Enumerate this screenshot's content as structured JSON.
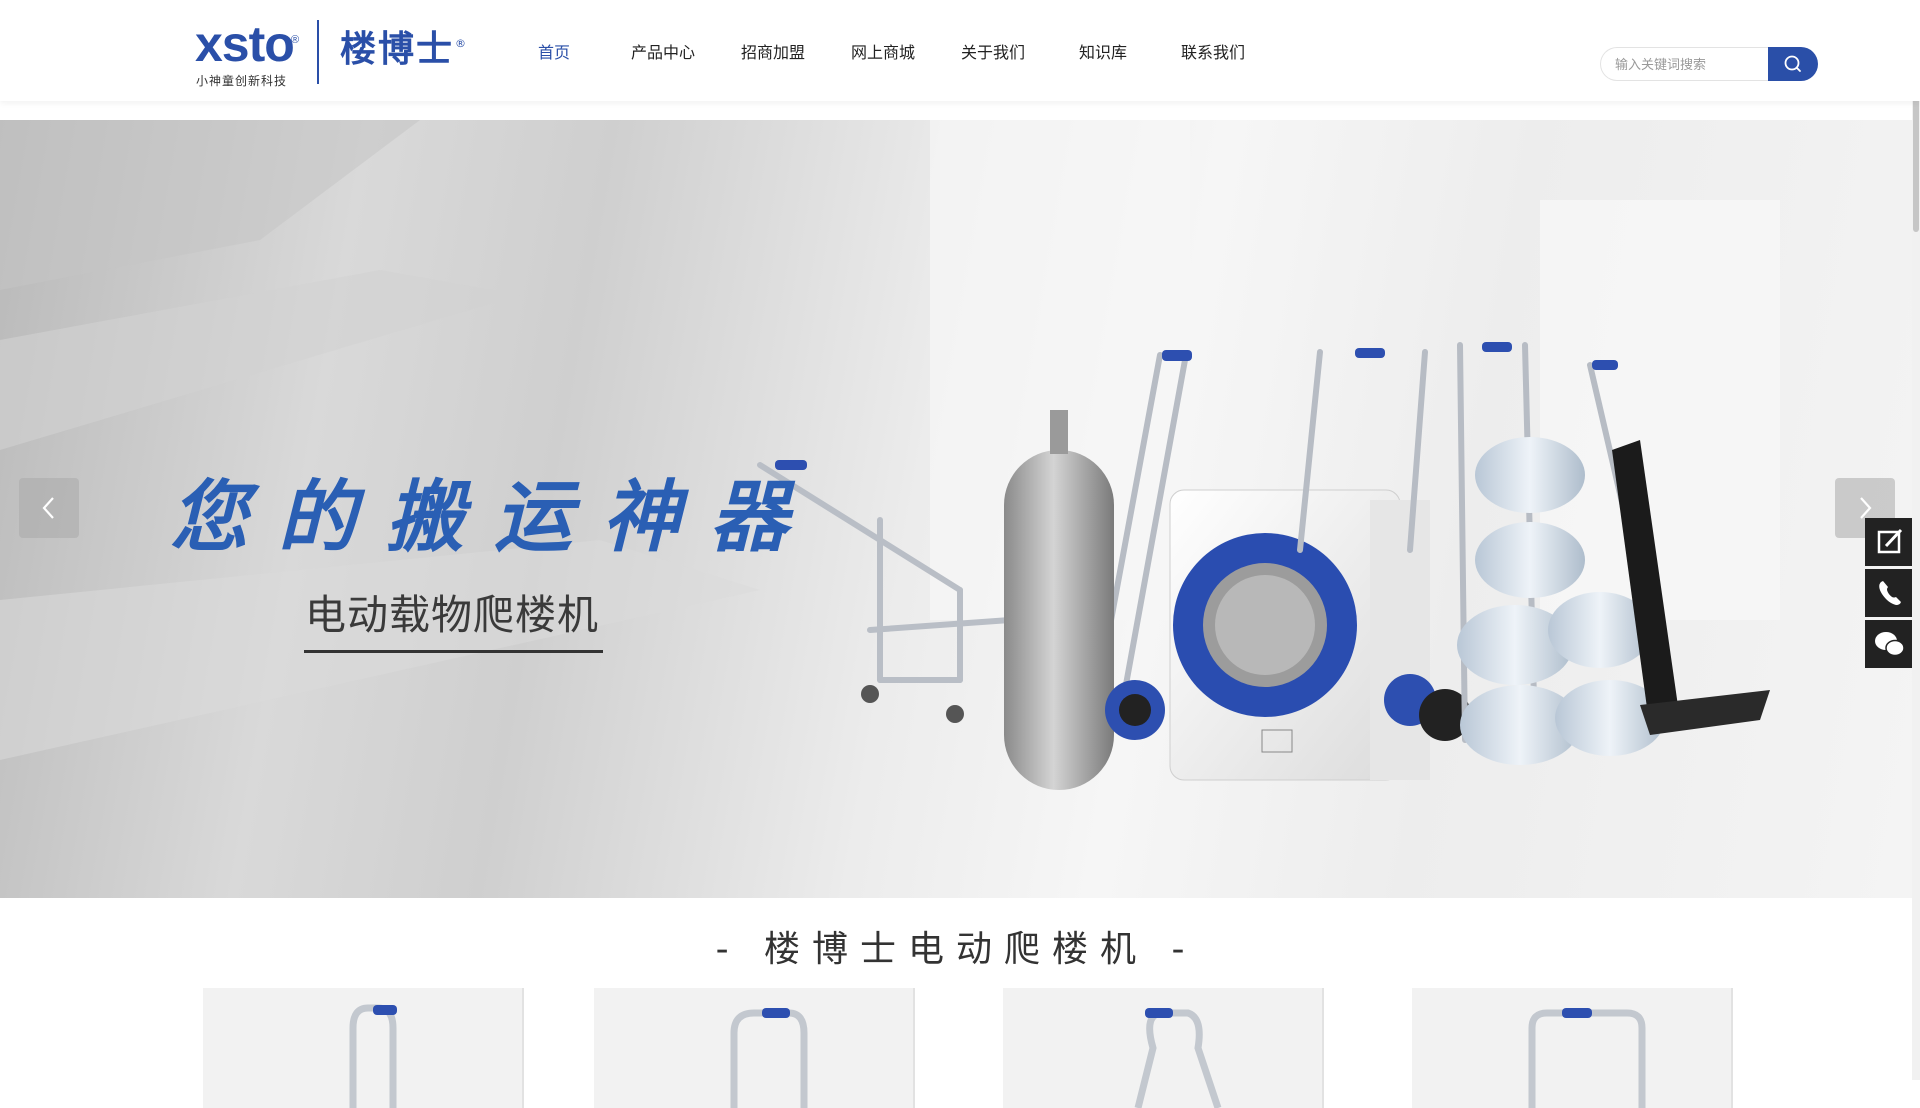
{
  "header": {
    "logo": {
      "brand_en": "xsto",
      "brand_sub": "小神童创新科技",
      "brand_cn": "楼博士",
      "reg_mark": "®"
    },
    "nav": [
      {
        "label": "首页",
        "active": true
      },
      {
        "label": "产品中心",
        "active": false
      },
      {
        "label": "招商加盟",
        "active": false
      },
      {
        "label": "网上商城",
        "active": false
      },
      {
        "label": "关于我们",
        "active": false
      },
      {
        "label": "知识库",
        "active": false
      },
      {
        "label": "联系我们",
        "active": false
      }
    ],
    "search": {
      "placeholder": "输入关键词搜索",
      "button_icon": "search-icon"
    }
  },
  "banner": {
    "slogan": "您的搬运神器",
    "subtitle": "电动载物爬楼机",
    "prev_icon": "chevron-left-icon",
    "next_icon": "chevron-right-icon"
  },
  "side_tools": [
    {
      "icon": "edit-icon"
    },
    {
      "icon": "phone-icon"
    },
    {
      "icon": "wechat-icon"
    }
  ],
  "section": {
    "title": "- 楼博士电动爬楼机 -",
    "product_count_visible": 4
  },
  "colors": {
    "brand_blue": "#2a4fa8",
    "slogan_blue": "#2a5fb4",
    "side_tool_bg": "#222222",
    "nav_active": "#2a4fa8"
  }
}
